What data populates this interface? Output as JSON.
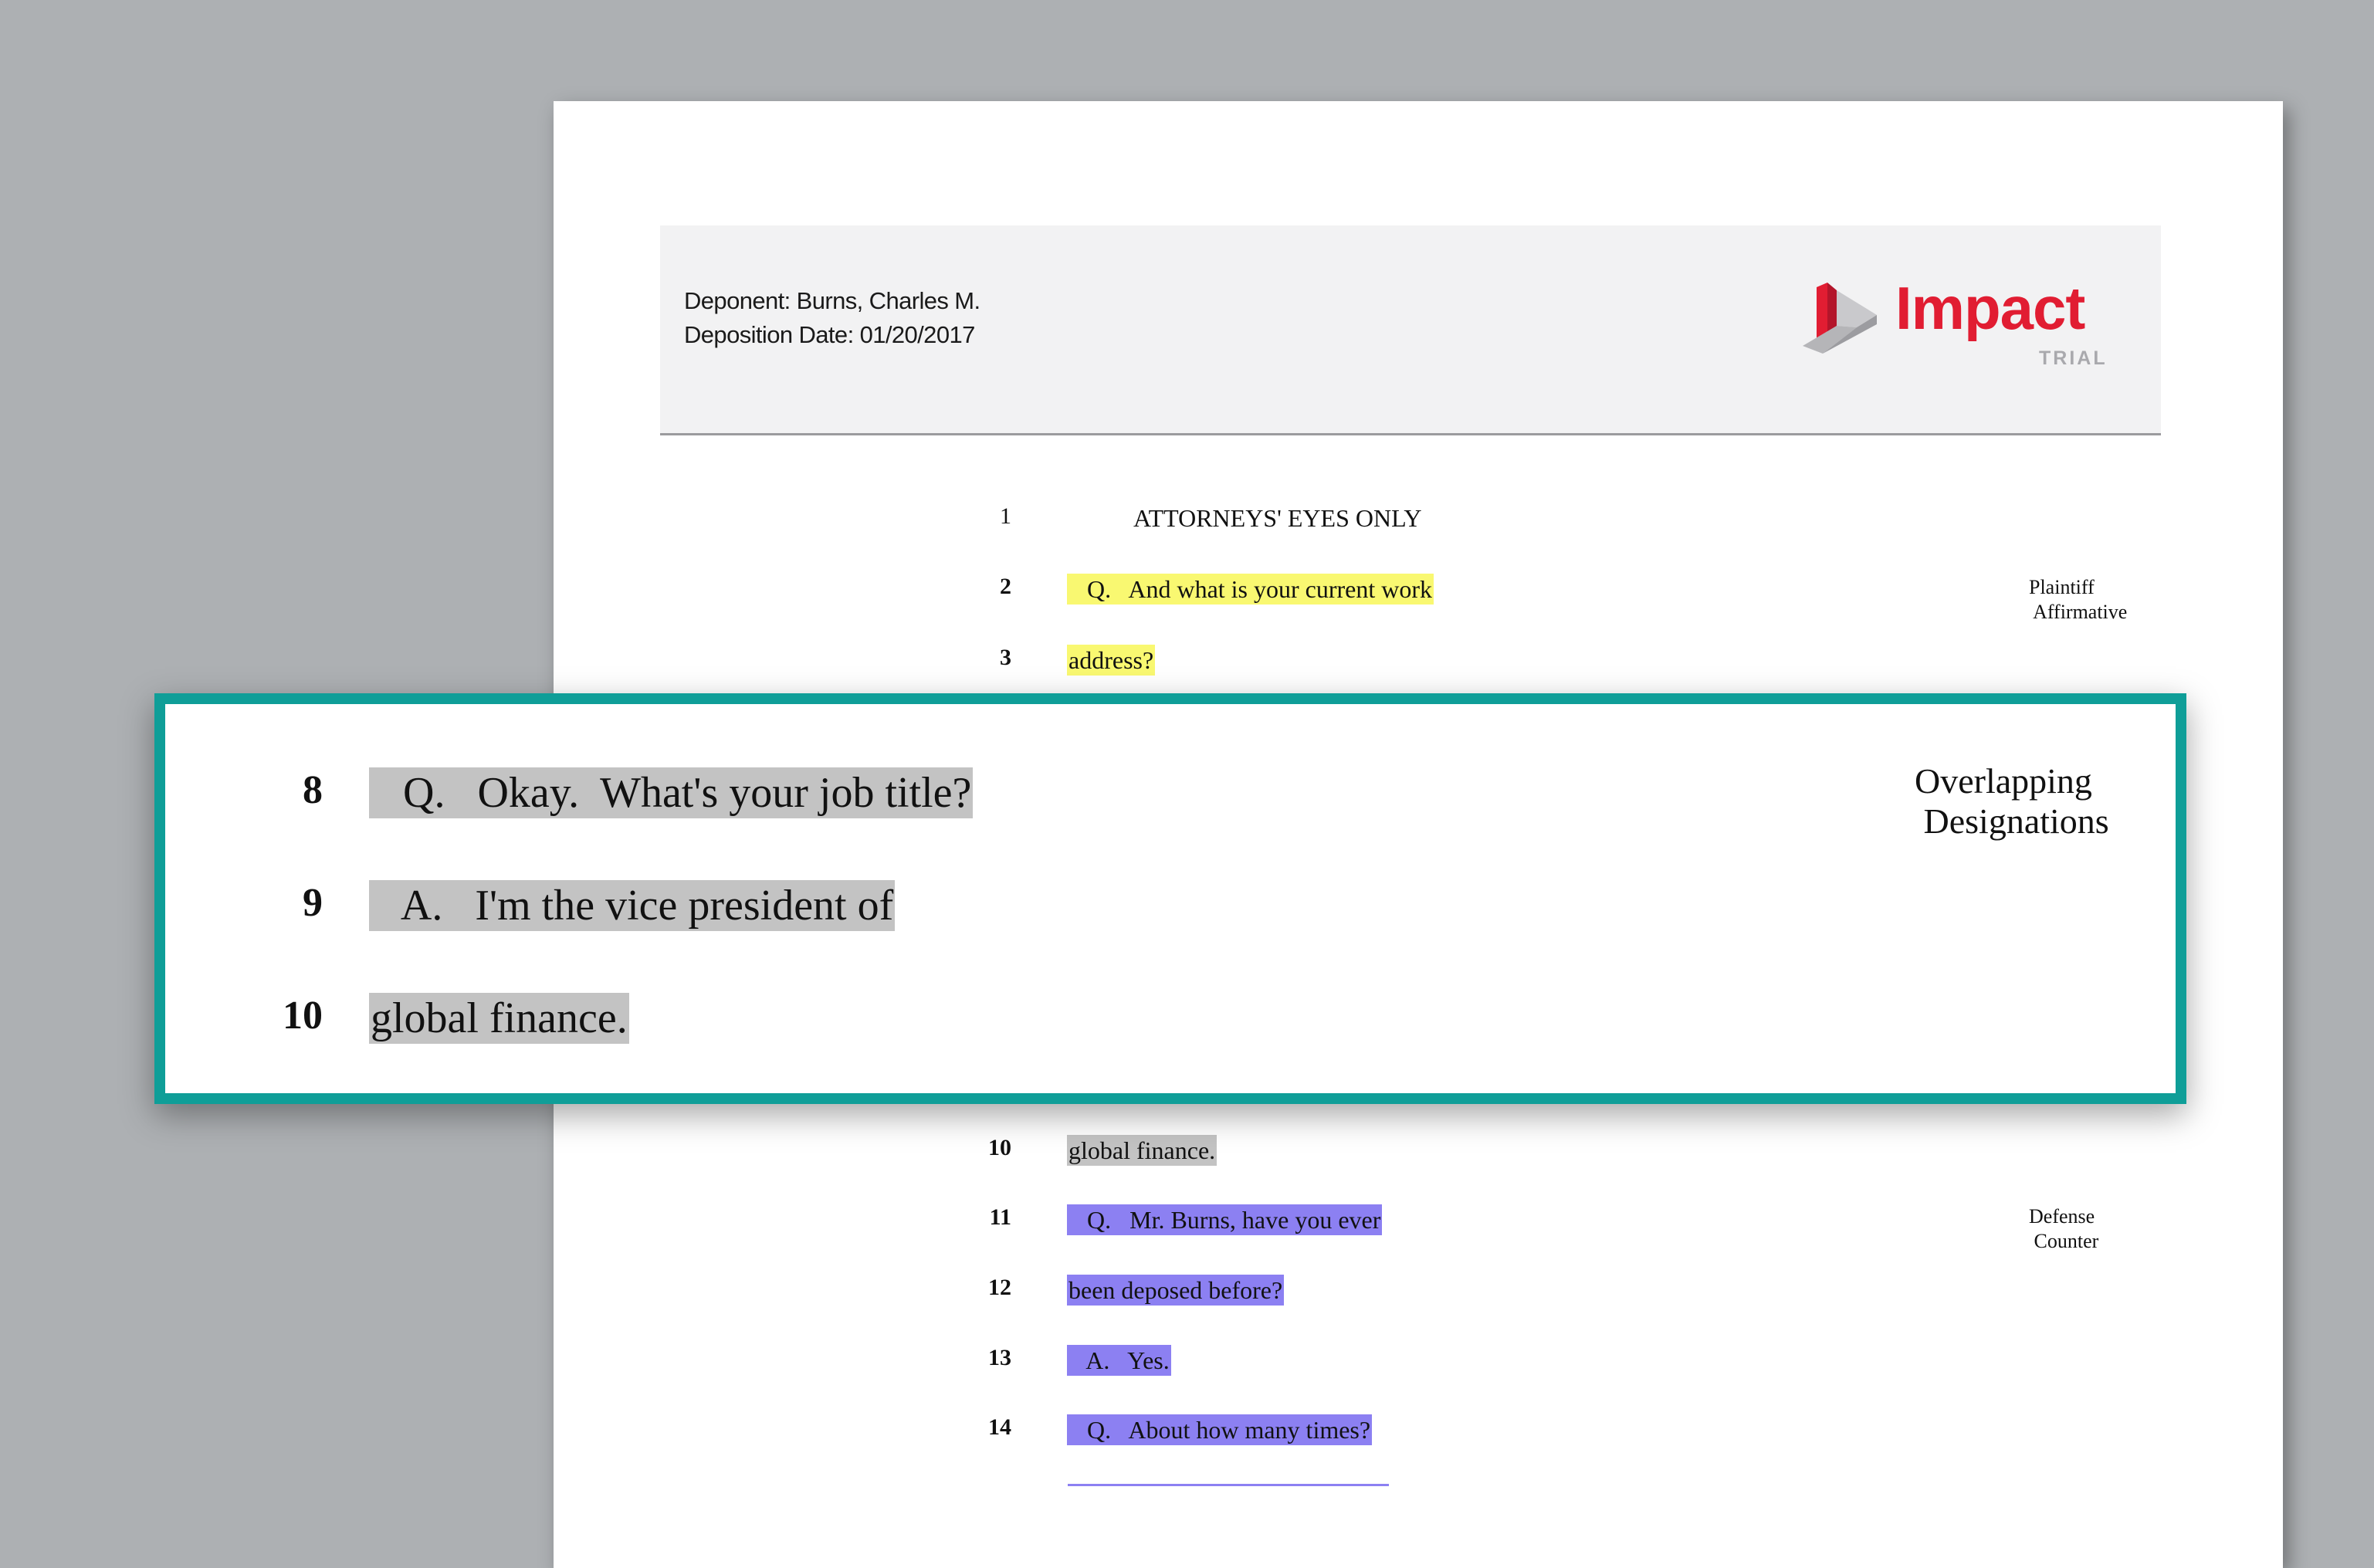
{
  "header": {
    "deponent": "Deponent: Burns, Charles M.",
    "deposition_date": "Deposition Date: 01/20/2017"
  },
  "logo": {
    "word": "Impact",
    "sub": "TRIAL",
    "brand_color": "#e11d32"
  },
  "transcript": {
    "lines": [
      {
        "num": "1",
        "text": "ATTORNEYS' EYES ONLY"
      },
      {
        "num": "2",
        "text": "   Q.   And what is your current work"
      },
      {
        "num": "3",
        "text": "address?"
      },
      {
        "num": "10",
        "text": "global finance."
      },
      {
        "num": "11",
        "text": "   Q.   Mr. Burns, have you ever"
      },
      {
        "num": "12",
        "text": "been deposed before?"
      },
      {
        "num": "13",
        "text": "   A.   Yes."
      },
      {
        "num": "14",
        "text": "   Q.   About how many times?"
      }
    ],
    "labels": {
      "plaintiff": "Plaintiff\n Affirmative",
      "defense": "Defense\n Counter"
    }
  },
  "callout": {
    "lines": [
      {
        "num": "8",
        "text": "   Q.   Okay.  What's your job title?"
      },
      {
        "num": "9",
        "text": "   A.   I'm the vice president of"
      },
      {
        "num": "10",
        "text": "global finance."
      }
    ],
    "label": "Overlapping\n Designations"
  },
  "colors": {
    "callout_border": "#0f9e98",
    "plaintiff_highlight": "#f9f871",
    "overlap_highlight": "#c3c3c3",
    "defense_highlight": "#8c80f2"
  }
}
